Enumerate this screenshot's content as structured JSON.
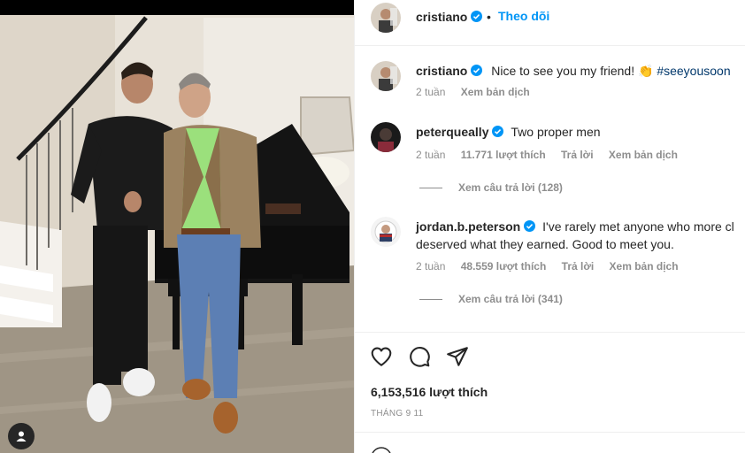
{
  "post": {
    "author": "cristiano",
    "follow_label": "Theo dõi",
    "separator": "•",
    "caption": {
      "username": "cristiano",
      "text": "Nice to see you my friend! ",
      "emoji": "👏",
      "hashtag": "#seeyousoon",
      "time": "2 tuần",
      "translate": "Xem bản dịch"
    },
    "comments": [
      {
        "username": "peterqueally",
        "text": "Two proper men",
        "time": "2 tuần",
        "likes": "11.771 lượt thích",
        "reply": "Trả lời",
        "translate": "Xem bản dịch",
        "view_replies": "Xem câu trả lời (128)"
      },
      {
        "username": "jordan.b.peterson",
        "text_line1": "I've rarely met anyone who more cl",
        "text_line2": "deserved what they earned. Good to meet you.",
        "time": "2 tuần",
        "likes": "48.559 lượt thích",
        "reply": "Trả lời",
        "translate": "Xem bản dịch",
        "view_replies": "Xem câu trả lời (341)"
      }
    ],
    "like_count": "6,153,516 lượt thích",
    "date": "THÁNG 9 11"
  },
  "icons": {
    "like": "heart-icon",
    "comment": "comment-icon",
    "share": "paper-plane-icon",
    "verified": "verified-badge-icon",
    "tag": "user-tag-icon"
  },
  "colors": {
    "accent": "#0095f6",
    "verified": "#0095f6",
    "hashtag": "#00376b",
    "muted": "#8e8e8e"
  }
}
